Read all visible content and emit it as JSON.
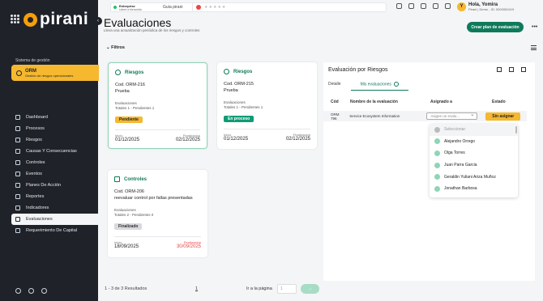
{
  "sidebar": {
    "logo": "pirani",
    "mgmt_label": "Sistema de gestión",
    "orm": {
      "title": "ORM",
      "subtitle": "Gestión de riesgos operacionales"
    },
    "items": [
      {
        "label": "Dashboard"
      },
      {
        "label": "Procesos"
      },
      {
        "label": "Riesgos"
      },
      {
        "label": "Causas Y Consecuencias"
      },
      {
        "label": "Controles"
      },
      {
        "label": "Eventos"
      },
      {
        "label": "Planes De Acción"
      },
      {
        "label": "Reportes"
      },
      {
        "label": "Indicadores"
      },
      {
        "label": "Evaluaciones"
      },
      {
        "label": "Requerimiento De Capital"
      }
    ]
  },
  "topbar": {
    "env_name": "Enterprise",
    "env_sub": "Usted a bienvoids",
    "env_select": "Guía pirani",
    "stars": "★★★★★",
    "notif_count": "1",
    "user_initial": "Y",
    "user_name": "Hola, Yomira",
    "user_sub": "Pirani | Demo - ID: 0000000419"
  },
  "page": {
    "title": "Evaluaciones",
    "subtitle": "Lleva una actualización periódica de los riesgos y controles",
    "create_button": "Crear plan de evaluación",
    "more": "•••",
    "filters": "Filtros"
  },
  "cards": [
    {
      "type": "Riesgos",
      "code": "Cod. ORM-216",
      "desc": "Prueba",
      "eval_label": "Evaluaciones",
      "totals": "Totales 1 - Pendientes 1",
      "status": "Pendiente",
      "start_label": "Inicio",
      "start": "01/12/2025",
      "end_label": "Finalización",
      "end": "02/12/2025"
    },
    {
      "type": "Riesgos",
      "code": "Cod. ORM-215",
      "desc": "Prueba",
      "eval_label": "Evaluaciones",
      "totals": "Totales 1 - Pendientes 1",
      "status": "En proceso",
      "start_label": "Inicio",
      "start": "01/12/2025",
      "end_label": "Finalización",
      "end": "02/12/2025"
    },
    {
      "type": "Controles",
      "code": "Cod. ORM-206",
      "desc": "reevaluar control por fallas presentadas",
      "eval_label": "Evaluaciones",
      "totals": "Totales 2 - Pendientes 0",
      "status": "Finalizado",
      "start_label": "Inicio",
      "start": "18/09/2025",
      "end_label": "Finalización",
      "end": "30/09/2025"
    }
  ],
  "pagination": {
    "results": "1 - 3 de 3 Resultados",
    "page": "1",
    "goto_label": "Ir a la página",
    "input_value": "1",
    "go_button": "→"
  },
  "panel": {
    "title": "Evaluación por Riesgos",
    "tabs": [
      "Detalle",
      "Mis evaluaciones"
    ],
    "columns": [
      "Cód",
      "Nombre de la evaluación",
      "Asignado a",
      "Estado"
    ],
    "row": {
      "code": "ORM 796",
      "name": "Service Ecosystem Information",
      "assign_placeholder": "Asigne un evalu...",
      "status": "Sin asignar"
    },
    "dropdown": [
      "Seleccionar",
      "Alejandro Orrego",
      "Olga Torres",
      "Juan Parra Garcia",
      "Geraldin Yuliani Ariza Muñoz",
      "Jonathan Barbosa"
    ]
  }
}
